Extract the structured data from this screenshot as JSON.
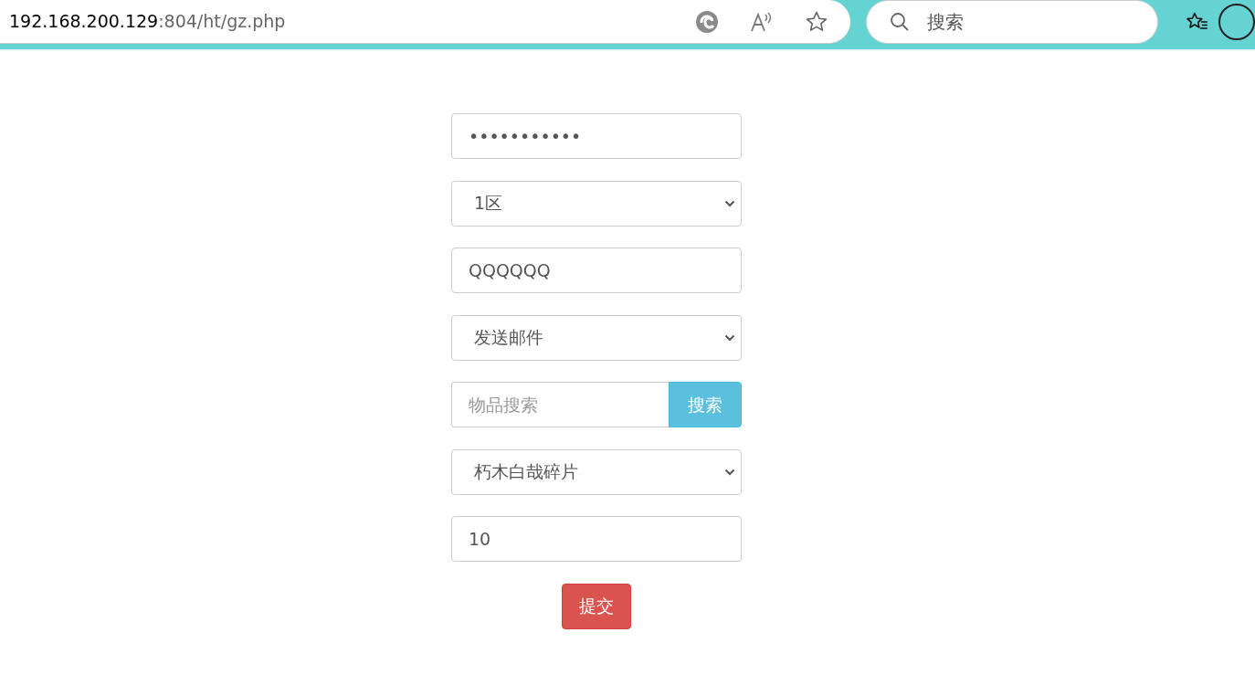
{
  "browser": {
    "address": {
      "host": "192.168.200.129",
      "path": ":804/ht/gz.php"
    },
    "search": {
      "placeholder": "搜索"
    }
  },
  "form": {
    "fields": [
      {
        "kind": "text",
        "value": "•••••••••••"
      },
      {
        "kind": "select",
        "value": "1区"
      },
      {
        "kind": "text",
        "value": "QQQQQQ"
      },
      {
        "kind": "select",
        "value": "发送邮件"
      },
      {
        "kind": "search",
        "placeholder": "物品搜索",
        "button": "搜索"
      },
      {
        "kind": "select",
        "value": "朽木白哉碎片"
      },
      {
        "kind": "text",
        "value": "10"
      }
    ],
    "submit": "提交"
  }
}
